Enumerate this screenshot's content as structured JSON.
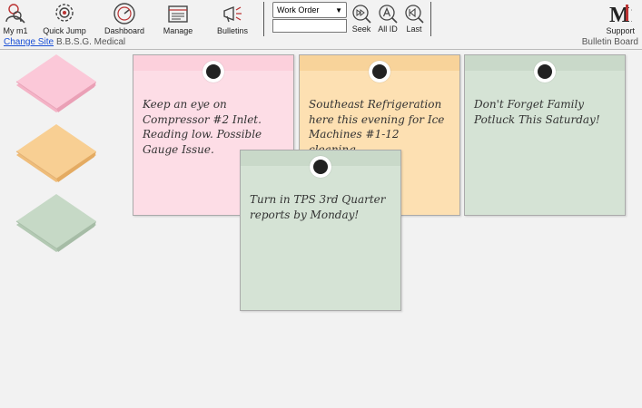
{
  "toolbar": {
    "buttons": [
      {
        "label": "My m1",
        "icon": "user-magnifier-icon"
      },
      {
        "label": "Quick Jump",
        "icon": "gear-icon"
      },
      {
        "label": "Dashboard",
        "icon": "gauge-icon"
      },
      {
        "label": "Manage",
        "icon": "monitor-icon"
      },
      {
        "label": "Bulletins",
        "icon": "megaphone-icon"
      }
    ],
    "search_type": "Work Order",
    "search_value": "",
    "seek_label": "Seek",
    "allid_label": "All ID",
    "last_label": "Last",
    "support_label": "Support",
    "logo_text": "M1"
  },
  "subbar": {
    "change_site": "Change Site",
    "site_name": "B.B.S.G. Medical",
    "page_label": "Bulletin Board"
  },
  "notes": [
    {
      "text": "Keep an eye on Compressor #2 Inlet. Reading low. Possible Gauge Issue.",
      "color": "#fddde6"
    },
    {
      "text": "Southeast Refrigeration here this evening for Ice Machines #1-12 cleaning.",
      "color": "#fde0b2"
    },
    {
      "text": "Don't Forget Family Potluck This Saturday!",
      "color": "#d5e3d5"
    },
    {
      "text": "Turn in TPS 3rd Quarter reports by Monday!",
      "color": "#d5e3d5"
    }
  ],
  "pads": [
    {
      "color": "#fbc8d8",
      "name": "pink"
    },
    {
      "color": "#f8cf93",
      "name": "orange"
    },
    {
      "color": "#c6d9c6",
      "name": "green"
    }
  ]
}
